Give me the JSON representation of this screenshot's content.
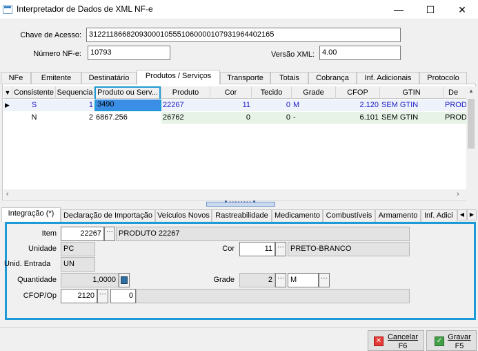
{
  "window": {
    "title": "Interpretador de Dados de XML NF-e",
    "minimize": "—",
    "maximize": "☐",
    "close": "✕"
  },
  "header": {
    "chave_label": "Chave de Acesso:",
    "chave_value": "31221186682093000105551060000107931964402165",
    "numero_label": "Número NF-e:",
    "numero_value": "10793",
    "versao_label": "Versão XML:",
    "versao_value": "4.00"
  },
  "tabs": [
    "NFe",
    "Emitente",
    "Destinatário",
    "Produtos / Serviços",
    "Transporte",
    "Totais",
    "Cobrança",
    "Inf. Adicionais",
    "Protocolo"
  ],
  "grid": {
    "headers": [
      "▼",
      "Consistente",
      "Sequencia",
      "Produto ou Serv...",
      "Produto",
      "Cor",
      "Tecido",
      "Grade",
      "CFOP",
      "GTIN",
      "De"
    ],
    "rows": [
      {
        "marker": "▶",
        "consistente": "S",
        "sequencia": "1",
        "produto_serv": "3490",
        "produto": "22267",
        "cor": "11",
        "tecido": "0",
        "grade": "M",
        "cfop": "2.120",
        "gtin": "SEM GTIN",
        "desc": "PRODU"
      },
      {
        "marker": "",
        "consistente": "N",
        "sequencia": "2",
        "produto_serv": "6867.256",
        "produto": "26762",
        "cor": "0",
        "tecido": "0",
        "grade": "-",
        "cfop": "6.101",
        "gtin": "SEM GTIN",
        "desc": "PRODU"
      }
    ]
  },
  "lower_tabs": [
    "Integração (*)",
    "Declaração de Importação",
    "Veículos Novos",
    "Rastreabilidade",
    "Medicamento",
    "Combustíveis",
    "Armamento",
    "Inf. Adici"
  ],
  "detail": {
    "item_label": "Item",
    "item_value": "22267",
    "item_desc": "PRODUTO 22267",
    "unidade_label": "Unidade",
    "unidade_value": "PC",
    "cor_label": "Cor",
    "cor_value": "11",
    "cor_desc": "PRETO-BRANCO",
    "unid_entrada_label": "Unid. Entrada",
    "unid_entrada_value": "UN",
    "quantidade_label": "Quantidade",
    "quantidade_value": "1,0000",
    "grade_label": "Grade",
    "grade_value": "2",
    "grade_desc": "M",
    "cfop_label": "CFOP/Op",
    "cfop_value": "2120",
    "op_value": "0"
  },
  "buttons": {
    "cancelar": "Cancelar",
    "cancelar_key": "F6",
    "gravar": "Gravar",
    "gravar_key": "F5"
  }
}
